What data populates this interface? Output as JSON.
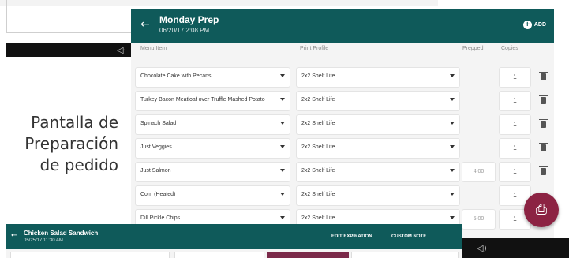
{
  "caption": {
    "line1": "Pantalla de",
    "line2": "Preparación",
    "line3": "de pedido"
  },
  "header": {
    "title": "Monday Prep",
    "subtitle": "06/20/17  2:08 PM",
    "add_label": "ADD"
  },
  "columns": {
    "menu_item": "Menu Item",
    "print_profile": "Print Profile",
    "prepped": "Prepped",
    "copies": "Copies"
  },
  "rows": [
    {
      "menu_item": "Chocolate Cake with Pecans",
      "profile": "2x2 Shelf Life",
      "prepped": "",
      "copies": "1"
    },
    {
      "menu_item": "Turkey Bacon Meatloaf over Truffle Mashed Potato",
      "profile": "2x2 Shelf Life",
      "prepped": "",
      "copies": "1"
    },
    {
      "menu_item": "Spinach Salad",
      "profile": "2x2 Shelf Life",
      "prepped": "",
      "copies": "1"
    },
    {
      "menu_item": "Just Veggies",
      "profile": "2x2 Shelf Life",
      "prepped": "",
      "copies": "1"
    },
    {
      "menu_item": "Just Salmon",
      "profile": "2x2 Shelf Life",
      "prepped": "4.00",
      "copies": "1"
    },
    {
      "menu_item": "Corn (Heated)",
      "profile": "2x2 Shelf Life",
      "prepped": "",
      "copies": "1"
    },
    {
      "menu_item": "Dill Pickle Chips",
      "profile": "2x2 Shelf Life",
      "prepped": "5.00",
      "copies": "1"
    }
  ],
  "fab": {
    "icon": "print-icon"
  },
  "second_screen": {
    "title": "Chicken Salad Sandwich",
    "subtitle": "05/25/17  11:30 AM",
    "action1": "EDIT EXPIRATION",
    "action2": "CUSTOM NOTE"
  },
  "colors": {
    "appbar": "#0f5a5a",
    "fab": "#8c2343"
  }
}
